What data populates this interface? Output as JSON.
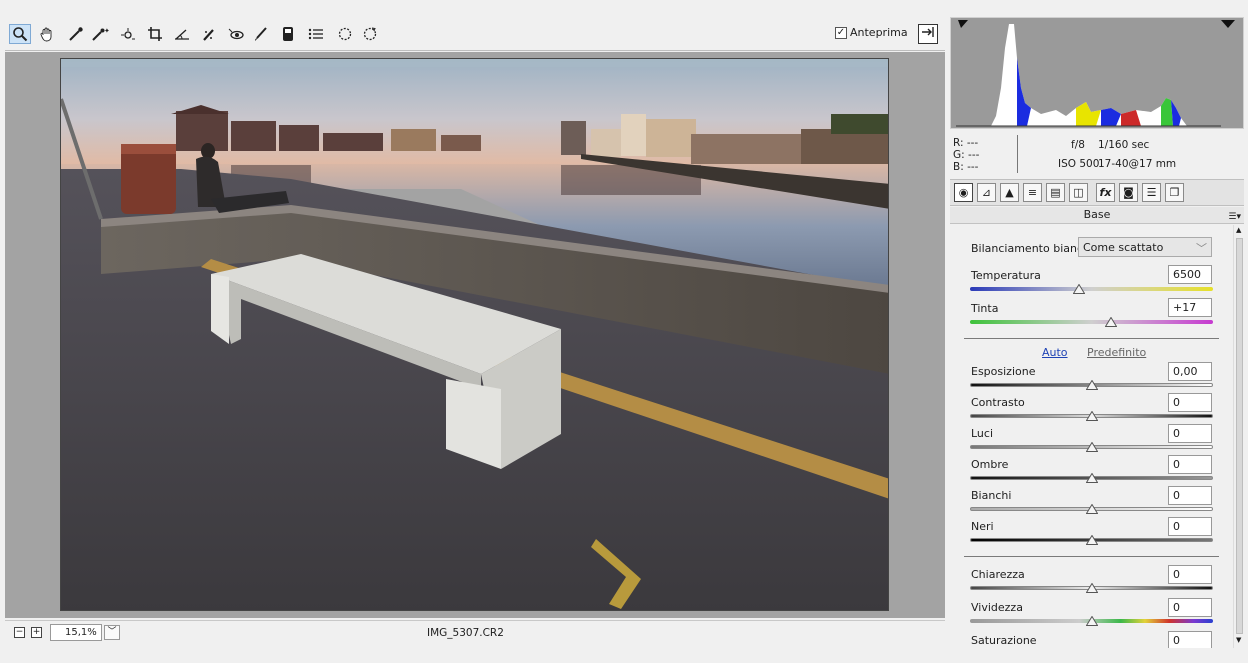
{
  "toolbar": {
    "tools": [
      "zoom-icon",
      "hand-icon",
      "white-balance-icon",
      "color-sampler-icon",
      "targeted-adjustment-icon",
      "crop-icon",
      "straighten-icon",
      "spot-removal-icon",
      "red-eye-icon",
      "adjustment-brush-icon",
      "graduated-filter-icon",
      "preferences-list-icon",
      "rotate-ccw-icon",
      "rotate-cw-icon"
    ],
    "preview_label": "Anteprima",
    "preview_checked": "✓"
  },
  "status": {
    "zoom": "15,1%",
    "filename": "IMG_5307.CR2",
    "zoom_out": "−",
    "zoom_in": "+"
  },
  "histogram_info": {
    "r_label": "R:",
    "r_value": "---",
    "g_label": "G:",
    "g_value": "---",
    "b_label": "B:",
    "b_value": "---",
    "aperture": "f/8",
    "shutter": "1/160 sec",
    "iso": "ISO 500",
    "lens": "17-40@17 mm"
  },
  "tabs": [
    "basic-icon",
    "tone-curve-icon",
    "detail-icon",
    "hsl-icon",
    "split-toning-icon",
    "lens-corrections-icon",
    "effects-icon",
    "camera-calibration-icon",
    "presets-icon",
    "snapshots-icon"
  ],
  "panel": {
    "title": "Base",
    "wb_label": "Bilanciamento bianco:",
    "wb_value": "Come scattato",
    "temperature_label": "Temperatura",
    "temperature_value": "6500",
    "tint_label": "Tinta",
    "tint_value": "+17",
    "auto_link": "Auto",
    "default_link": "Predefinito",
    "exposure_label": "Esposizione",
    "exposure_value": "0,00",
    "contrast_label": "Contrasto",
    "contrast_value": "0",
    "highlights_label": "Luci",
    "highlights_value": "0",
    "shadows_label": "Ombre",
    "shadows_value": "0",
    "whites_label": "Bianchi",
    "whites_value": "0",
    "blacks_label": "Neri",
    "blacks_value": "0",
    "clarity_label": "Chiarezza",
    "clarity_value": "0",
    "vibrance_label": "Vividezza",
    "vibrance_value": "0",
    "saturation_label": "Saturazione",
    "saturation_value": "0"
  },
  "sliders": {
    "temperature": 0.45,
    "tint": 0.58,
    "exposure": 0.5,
    "contrast": 0.5,
    "highlights": 0.5,
    "shadows": 0.5,
    "whites": 0.5,
    "blacks": 0.5,
    "clarity": 0.5,
    "vibrance": 0.5
  }
}
